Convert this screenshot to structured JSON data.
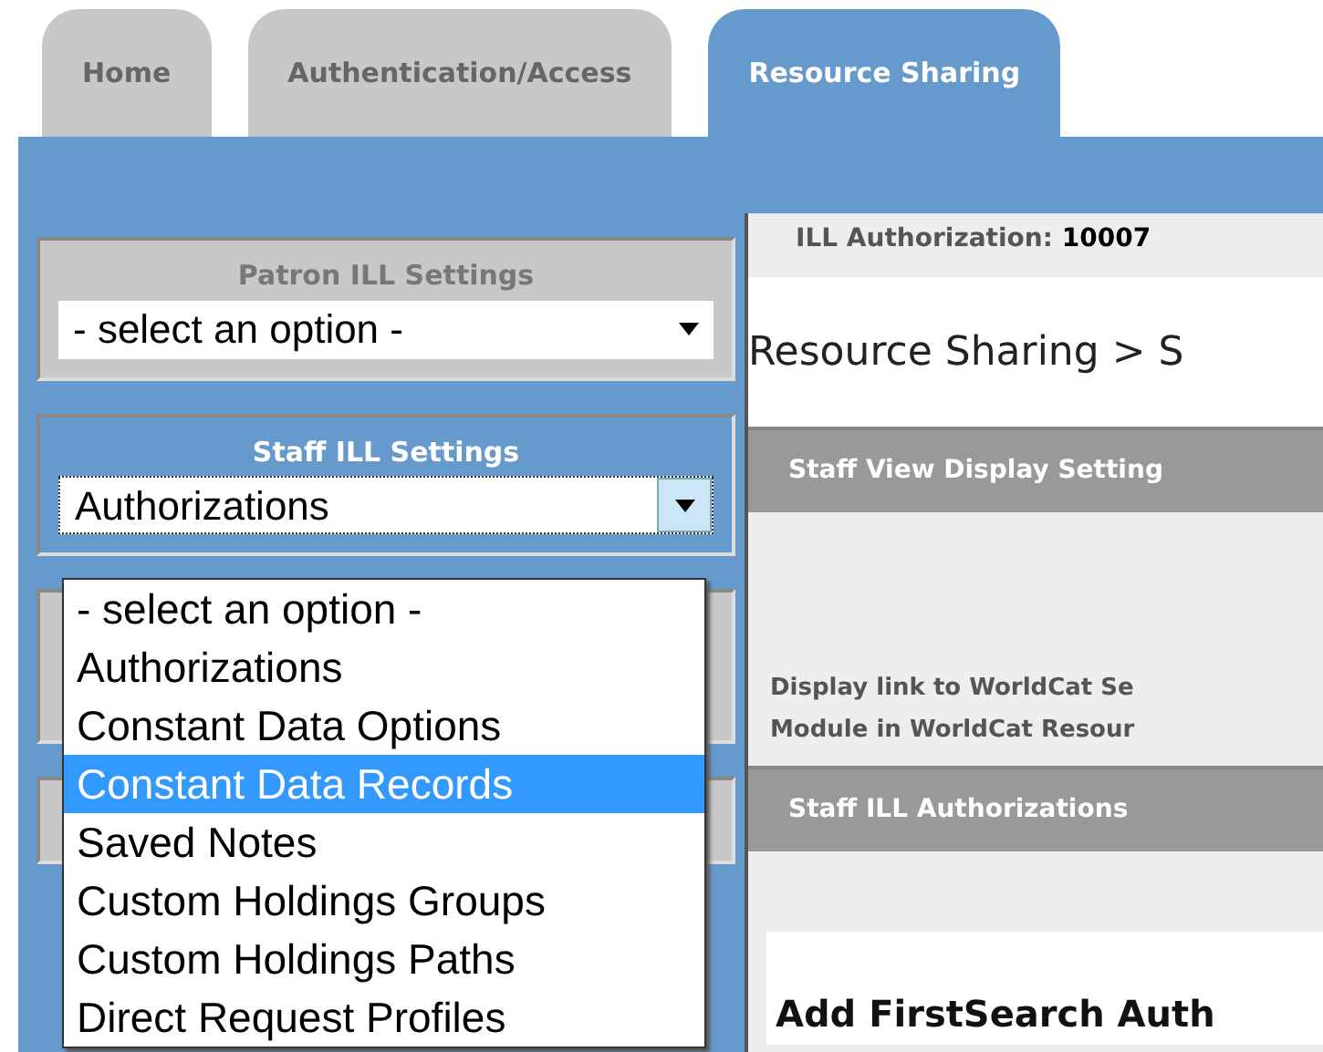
{
  "tabs": [
    {
      "label": "Home",
      "selected": false
    },
    {
      "label": "Authentication/Access",
      "selected": false
    },
    {
      "label": "Resource Sharing",
      "selected": true
    }
  ],
  "sidebar": {
    "panels": [
      {
        "kind": "dropdown",
        "title": "Patron ILL Settings",
        "value": "- select an option -",
        "active": false,
        "expanded": false
      },
      {
        "kind": "dropdown",
        "title": "Staff ILL Settings",
        "value": "Authorizations",
        "active": true,
        "expanded": true,
        "options": [
          {
            "label": "- select an option -",
            "highlighted": false
          },
          {
            "label": "Authorizations",
            "highlighted": false
          },
          {
            "label": "Constant Data Options",
            "highlighted": false
          },
          {
            "label": "Constant Data Records",
            "highlighted": true
          },
          {
            "label": "Saved Notes",
            "highlighted": false
          },
          {
            "label": "Custom Holdings Groups",
            "highlighted": false
          },
          {
            "label": "Custom Holdings Paths",
            "highlighted": false
          },
          {
            "label": "Direct Request Profiles",
            "highlighted": false
          }
        ]
      },
      {
        "kind": "covered"
      },
      {
        "kind": "covered"
      }
    ]
  },
  "content": {
    "auth_label": "ILL Authorization:",
    "auth_number": "10007",
    "breadcrumb": "Resource Sharing > S",
    "sections": [
      {
        "kind": "header",
        "text": "Staff View Display Setting"
      },
      {
        "kind": "text",
        "text": "Display link to WorldCat Se"
      },
      {
        "kind": "text",
        "text": "Module in WorldCat Resour"
      },
      {
        "kind": "header",
        "text": "Staff ILL Authorizations"
      },
      {
        "kind": "title",
        "text": "Add FirstSearch Auth"
      }
    ]
  }
}
